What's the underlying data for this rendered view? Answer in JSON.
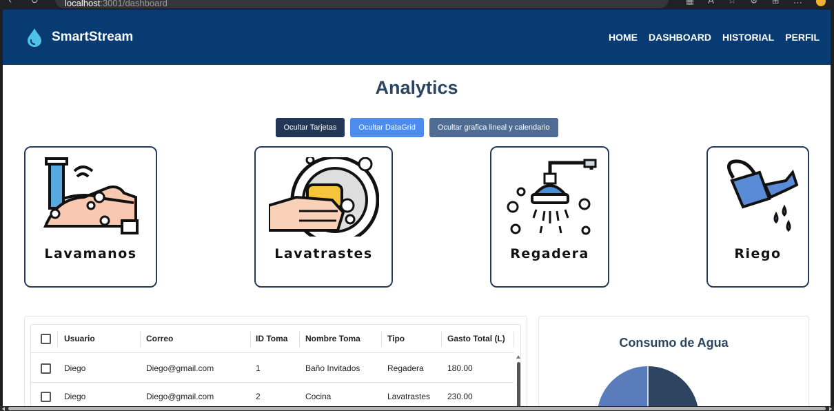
{
  "browser": {
    "url_host": "localhost",
    "url_path": ":3001/dashboard",
    "nav_icons": [
      "back-icon",
      "reload-icon"
    ],
    "tool_icons": [
      "grid-icon",
      "read-aloud-icon",
      "font-icon",
      "favorite-icon",
      "extensions-icon",
      "split-icon",
      "collections-icon",
      "add-tab-icon",
      "sync-icon",
      "more-icon"
    ]
  },
  "navbar": {
    "brand": "SmartStream",
    "brand_icon": "water-drop-icon",
    "links": [
      "HOME",
      "DASHBOARD",
      "HISTORIAL",
      "PERFIL"
    ],
    "background": "#073b72"
  },
  "page": {
    "title": "Analytics"
  },
  "toggles": {
    "hide_cards": "Ocultar Tarjetas",
    "hide_datagrid": "Ocultar DataGrid",
    "hide_chart_calendar": "Ocultar grafica lineal y calendario"
  },
  "cards": [
    {
      "label": "Lavamanos",
      "icon": "hand-washing-icon"
    },
    {
      "label": "Lavatrastes",
      "icon": "dish-washing-icon"
    },
    {
      "label": "Regadera",
      "icon": "shower-icon"
    },
    {
      "label": "Riego",
      "icon": "watering-can-icon"
    }
  ],
  "datagrid": {
    "columns": [
      "Usuario",
      "Correo",
      "ID Toma",
      "Nombre Toma",
      "Tipo",
      "Gasto Total (L)"
    ],
    "rows": [
      [
        "Diego",
        "Diego@gmail.com",
        "1",
        "Baño Invitados",
        "Regadera",
        "180.00"
      ],
      [
        "Diego",
        "Diego@gmail.com",
        "2",
        "Cocina",
        "Lavatrastes",
        "230.00"
      ]
    ]
  },
  "chart": {
    "title": "Consumo de Agua",
    "colors": [
      "#2e4460",
      "#5a7cbb"
    ]
  }
}
